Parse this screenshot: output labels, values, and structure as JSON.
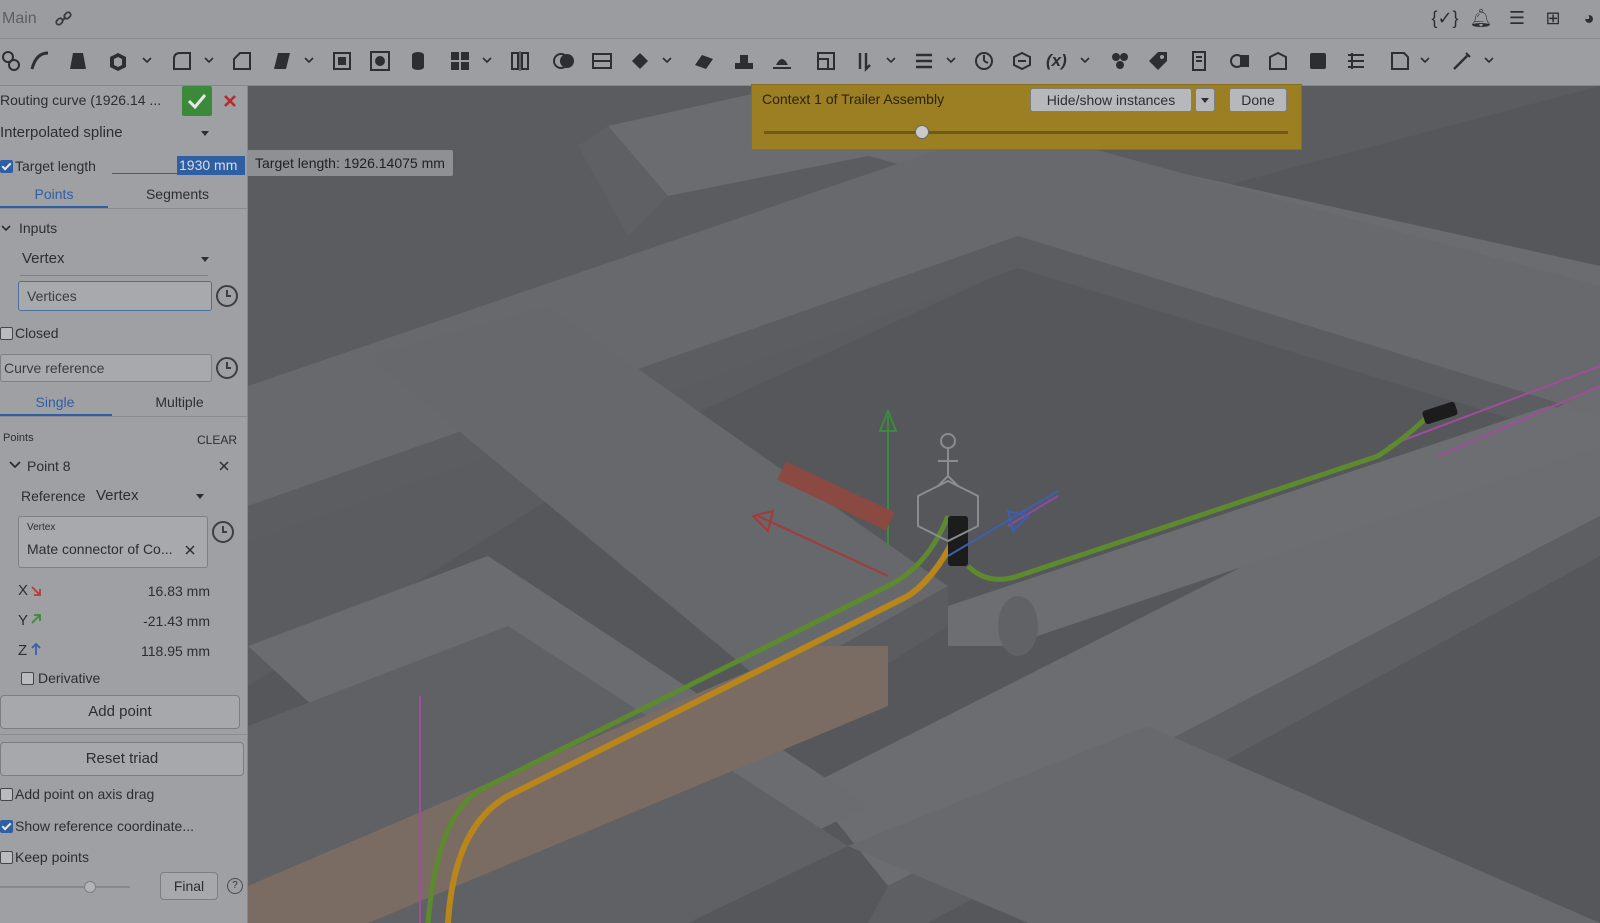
{
  "topbar": {
    "doc_name": "Main",
    "icons": [
      "link-icon",
      "variables-icon",
      "bell-icon",
      "list-icon",
      "apps-icon",
      "help-icon"
    ]
  },
  "toolbar": {
    "tools": [
      "sketch-icon",
      "sweep-icon",
      "loft-icon",
      "shell-icon",
      "fillet-icon",
      "chamfer-icon",
      "draft-icon",
      "plane-icon",
      "hole-icon",
      "cylinder-icon",
      "pattern-icon",
      "mirror-icon",
      "boolean-icon",
      "split-icon",
      "transform-icon",
      "sheetmetal-icon",
      "frame-icon",
      "gusset-icon",
      "layout-icon",
      "routing-icon",
      "wrap-icon",
      "helix-icon",
      "measure-icon",
      "variable-icon",
      "fixture-icon",
      "tag-icon",
      "feature-a-icon",
      "feature-b-icon",
      "feature-c-icon",
      "feature-d-icon",
      "feature-e-icon",
      "feature-f-icon",
      "pen-icon"
    ],
    "variable_glyph": "(x)"
  },
  "panel": {
    "feature_name": "Routing curve (1926.14 ...",
    "curve_type": "Interpolated spline",
    "target_length_label": "Target length",
    "target_length_value": "1930 mm",
    "target_length_checked": true,
    "tabs": [
      "Points",
      "Segments"
    ],
    "inputs_header": "Inputs",
    "input_type": "Vertex",
    "vertices_placeholder": "Vertices",
    "closed_label": "Closed",
    "curve_reference_placeholder": "Curve reference",
    "mode_tabs": [
      "Single",
      "Multiple"
    ],
    "points_label": "Points",
    "clear_label": "CLEAR",
    "point_name": "Point 8",
    "reference_label": "Reference",
    "reference_value": "Vertex",
    "vertex_label": "Vertex",
    "vertex_value": "Mate connector of Co...",
    "coords": [
      {
        "axis": "X",
        "value": "16.83 mm",
        "color": "#b83a3a"
      },
      {
        "axis": "Y",
        "value": "-21.43 mm",
        "color": "#3a8a3a"
      },
      {
        "axis": "Z",
        "value": "118.95 mm",
        "color": "#3a5fb0"
      }
    ],
    "derivative_label": "Derivative",
    "add_point_label": "Add point",
    "reset_triad_label": "Reset triad",
    "add_point_on_axis_drag_label": "Add point on axis drag",
    "show_reference_label": "Show reference coordinate...",
    "keep_points_label": "Keep points",
    "final_label": "Final",
    "help_glyph": "?"
  },
  "tooltip": {
    "text": "Target length: 1926.14075 mm"
  },
  "context": {
    "title": "Context 1 of Trailer Assembly",
    "hide_show_label": "Hide/show instances",
    "done_label": "Done",
    "slider_value": 0.3
  },
  "colors": {
    "accent": "#2f5fa3",
    "confirm": "#3a8a3a",
    "cancel": "#b82a2a",
    "context_banner": "#9c7e23",
    "route_orange": "#b8861a",
    "route_green": "#5d8a2e"
  }
}
